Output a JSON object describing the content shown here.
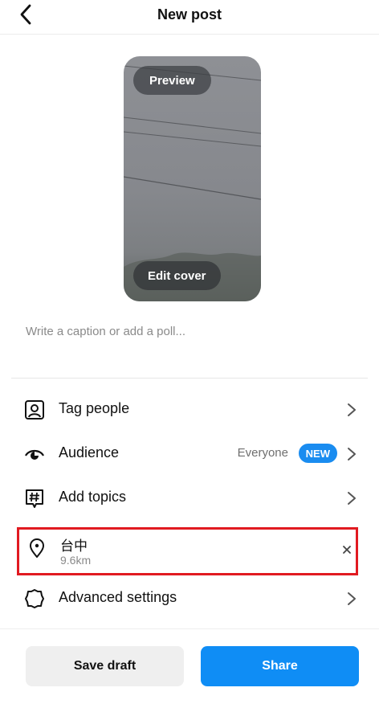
{
  "header": {
    "title": "New post",
    "back_icon": "chevron-left-icon"
  },
  "preview": {
    "preview_label": "Preview",
    "edit_cover_label": "Edit cover"
  },
  "caption": {
    "placeholder": "Write a caption or add a poll..."
  },
  "rows": {
    "tag_people": {
      "label": "Tag people",
      "icon": "tag-person-icon"
    },
    "audience": {
      "label": "Audience",
      "value": "Everyone",
      "badge": "NEW",
      "icon": "eye-icon"
    },
    "add_topics": {
      "label": "Add topics",
      "icon": "hashtag-icon"
    },
    "location": {
      "name": "台中",
      "distance": "9.6km",
      "icon": "location-pin-icon"
    },
    "advanced_settings": {
      "label": "Advanced settings",
      "icon": "gear-icon"
    }
  },
  "buttons": {
    "save_draft": "Save draft",
    "share": "Share"
  },
  "colors": {
    "accent": "#0f8df5",
    "badge": "#1a8cf0",
    "highlight_border": "#e11a21"
  }
}
